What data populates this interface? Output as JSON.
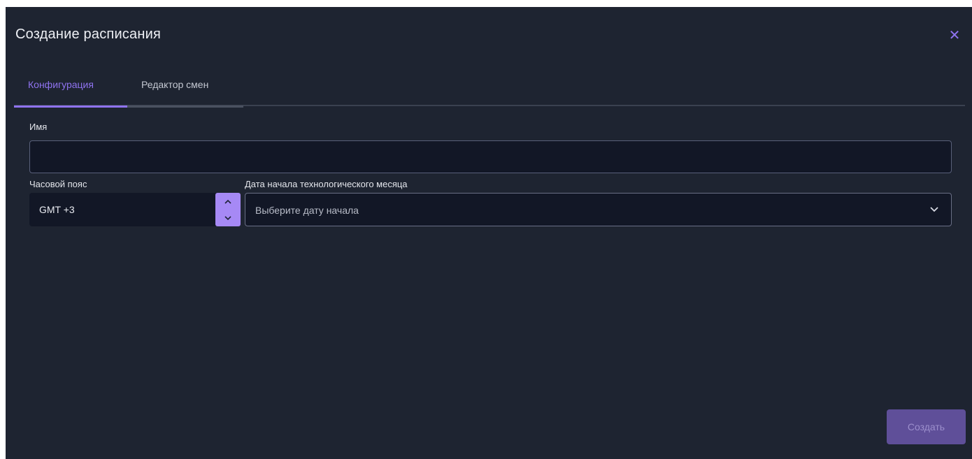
{
  "dialog": {
    "title": "Создание расписания",
    "close_icon": "close-icon"
  },
  "tabs": [
    {
      "label": "Конфигурация",
      "active": true
    },
    {
      "label": "Редактор смен",
      "active": false
    }
  ],
  "form": {
    "name": {
      "label": "Имя",
      "value": ""
    },
    "timezone": {
      "label": "Часовой пояс",
      "value": "GMT +3"
    },
    "start_date": {
      "label": "Дата начала технологического месяца",
      "placeholder": "Выберите дату начала"
    }
  },
  "actions": {
    "create_label": "Создать"
  },
  "colors": {
    "background": "#1e2431",
    "accent": "#8f73f0",
    "stepper": "#a689f5",
    "button_disabled": "#5f4f99"
  }
}
